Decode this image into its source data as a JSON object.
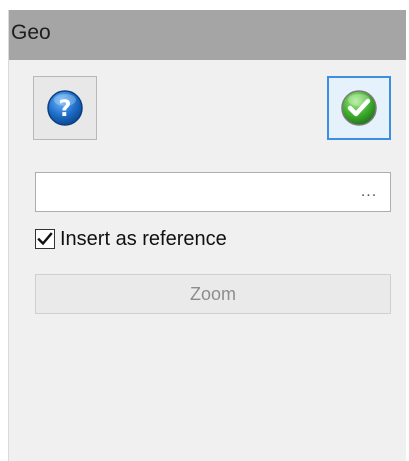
{
  "window": {
    "title": "Geo"
  },
  "toolbar": {
    "help_icon": "help-question-icon",
    "ok_icon": "green-checkmark-icon"
  },
  "path_field": {
    "value": "",
    "browse_label": "..."
  },
  "options": {
    "insert_as_reference_label": "Insert as reference",
    "insert_as_reference_checked": true
  },
  "zoom_button": {
    "label": "Zoom",
    "enabled": false
  },
  "colors": {
    "titlebar": "#a5a5a5",
    "panel": "#f0f0f0",
    "help_icon": "#1f6fc9",
    "ok_icon": "#3fae2f",
    "focus_border": "#3c8fe0"
  }
}
